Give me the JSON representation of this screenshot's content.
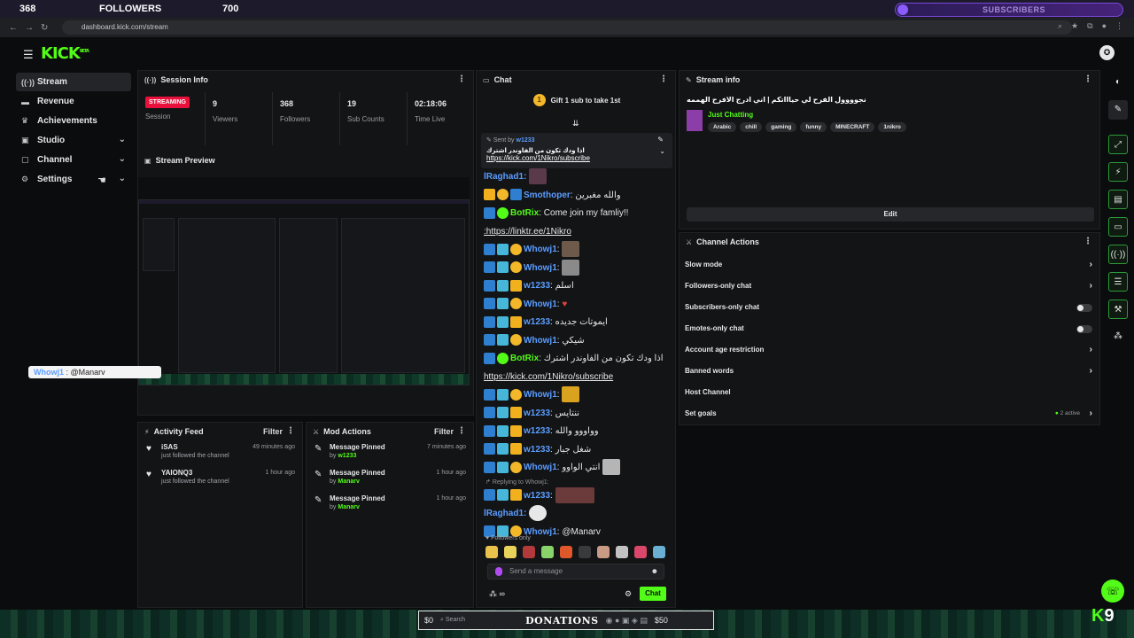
{
  "overlay": {
    "followers_count": "368",
    "followers_label": "FOLLOWERS",
    "followers_goal": "700",
    "subscribers_label": "SUBSCRIBERS"
  },
  "browser": {
    "url": "dashboard.kick.com/stream"
  },
  "app": {
    "logo": "KICK",
    "logo_badge": "BETA"
  },
  "sidebar": {
    "items": [
      {
        "label": "Stream",
        "icon": "radio-icon"
      },
      {
        "label": "Revenue",
        "icon": "money-icon"
      },
      {
        "label": "Achievements",
        "icon": "trophy-icon"
      },
      {
        "label": "Studio",
        "icon": "camera-icon"
      },
      {
        "label": "Channel",
        "icon": "user-icon"
      },
      {
        "label": "Settings",
        "icon": "gear-icon"
      }
    ]
  },
  "session": {
    "header": "Session Info",
    "status_badge": "STREAMING",
    "session_label": "Session",
    "viewers_value": "9",
    "viewers_label": "Viewers",
    "followers_value": "368",
    "followers_label": "Followers",
    "subs_value": "19",
    "subs_label": "Sub Counts",
    "time_value": "02:18:06",
    "time_label": "Time Live"
  },
  "preview": {
    "header": "Stream Preview"
  },
  "reply_chip": {
    "user": "Whowj1",
    "text": ": @Manarv"
  },
  "activity": {
    "header": "Activity Feed",
    "filter": "Filter",
    "items": [
      {
        "user": "iSAS",
        "desc": "just followed the channel",
        "time": "49 minutes ago"
      },
      {
        "user": "YAIONQ3",
        "desc": "just followed the channel",
        "time": "1 hour ago"
      }
    ]
  },
  "mod": {
    "header": "Mod Actions",
    "filter": "Filter",
    "items": [
      {
        "action": "Message Pinned",
        "by": "by",
        "user": "w1233",
        "time": "7 minutes ago"
      },
      {
        "action": "Message Pinned",
        "by": "by",
        "user": "Manarv",
        "time": "1 hour ago"
      },
      {
        "action": "Message Pinned",
        "by": "by",
        "user": "Manarv",
        "time": "1 hour ago"
      }
    ]
  },
  "chat": {
    "header": "Chat",
    "gift_text": "Gift 1 sub to take 1st",
    "gift_count": "1",
    "pinned": {
      "sent_by": "Sent by",
      "user": "w1233",
      "message": "اذا ودك تكون من الفاوندر اشترك",
      "link": "https://kick.com/1Nikro/subscribe"
    },
    "messages": [
      {
        "user": "lRaghad1",
        "text": "",
        "color": "blue"
      },
      {
        "user": "Smothoper",
        "text": "والله مغبرين",
        "color": "blue"
      },
      {
        "user": "BotRix",
        "text": "Come join my famliy!!",
        "color": "green"
      },
      {
        "user": "",
        "text": ":https://linktr.ee/1Nikro",
        "color": "link"
      },
      {
        "user": "Whowj1",
        "text": "",
        "color": "blue"
      },
      {
        "user": "Whowj1",
        "text": "",
        "color": "blue"
      },
      {
        "user": "w1233",
        "text": "اسلم",
        "color": "blue"
      },
      {
        "user": "Whowj1",
        "text": "",
        "color": "blue"
      },
      {
        "user": "w1233",
        "text": "ايموتات جديده",
        "color": "blue"
      },
      {
        "user": "Whowj1",
        "text": "شيكي",
        "color": "blue"
      },
      {
        "user": "BotRix",
        "text": ": اذا ودك تكون من الفاوندر اشترك",
        "color": "green"
      },
      {
        "user": "",
        "text": "https://kick.com/1Nikro/subscribe",
        "color": "link"
      },
      {
        "user": "Whowj1",
        "text": "",
        "color": "blue"
      },
      {
        "user": "w1233",
        "text": "ننتايس",
        "color": "blue"
      },
      {
        "user": "w1233",
        "text": "وواووو والله",
        "color": "blue"
      },
      {
        "user": "w1233",
        "text": "شغل جبار",
        "color": "blue"
      },
      {
        "user": "Whowj1",
        "text": "انتي الواوو",
        "color": "blue"
      }
    ],
    "reply_label": "Replying to Whowj1:",
    "messages2": [
      {
        "user": "w1233",
        "text": "",
        "color": "blue"
      },
      {
        "user": "lRaghad1",
        "text": "",
        "color": "blue"
      },
      {
        "user": "Whowj1",
        "text": "@Manarv",
        "color": "blue"
      }
    ],
    "followers_only": "Followers only",
    "input_placeholder": "Send a message",
    "chat_button": "Chat"
  },
  "stream_info": {
    "header": "Stream info",
    "title": "نجوووول الفرح لي حياااتكم | اني ادرج الافرح الهممه",
    "category": "Just Chatting",
    "tags": [
      "Arabic",
      "chill",
      "gaming",
      "funny",
      "MINECRAFT",
      "1nikro"
    ],
    "edit": "Edit"
  },
  "channel_actions": {
    "header": "Channel Actions",
    "rows": [
      {
        "label": "Slow mode",
        "kind": "arrow"
      },
      {
        "label": "Followers-only chat",
        "kind": "arrow"
      },
      {
        "label": "Subscribers-only chat",
        "kind": "toggle"
      },
      {
        "label": "Emotes-only chat",
        "kind": "toggle"
      },
      {
        "label": "Account age restriction",
        "kind": "arrow"
      },
      {
        "label": "Banned words",
        "kind": "arrow"
      },
      {
        "label": "Host Channel",
        "kind": "none"
      },
      {
        "label": "Set goals",
        "kind": "arrow",
        "extra": "2 active"
      }
    ]
  },
  "taskbar": {
    "left_amount": "$0",
    "search": "Search",
    "donations": "DONATIONS",
    "right_amount": "$50"
  },
  "corner": {
    "k": "K",
    "num": "9"
  }
}
